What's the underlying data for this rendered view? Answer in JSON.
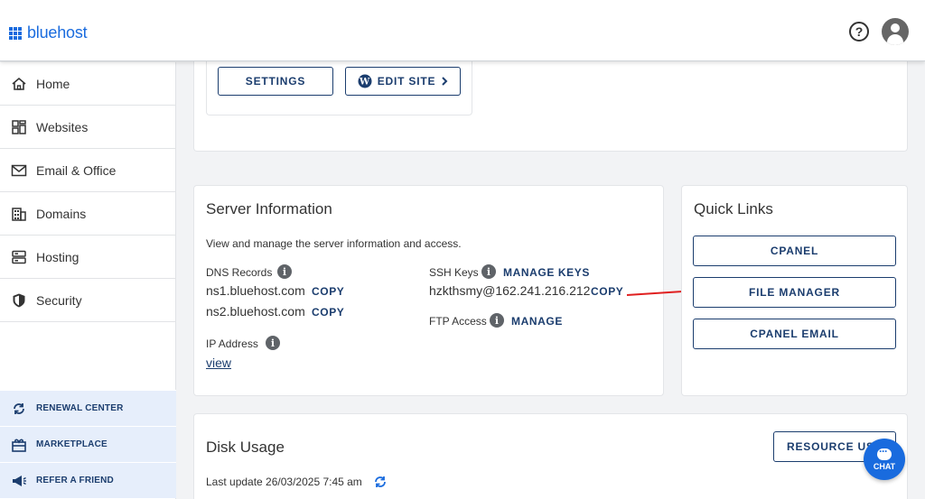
{
  "header": {
    "logo_text": "bluehost",
    "help_icon": "question-circle-icon",
    "avatar_icon": "user-avatar-icon"
  },
  "sidebar": {
    "items": [
      {
        "label": "Home",
        "icon": "home-icon"
      },
      {
        "label": "Websites",
        "icon": "websites-icon"
      },
      {
        "label": "Email & Office",
        "icon": "envelope-icon"
      },
      {
        "label": "Domains",
        "icon": "building-icon"
      },
      {
        "label": "Hosting",
        "icon": "server-icon"
      },
      {
        "label": "Security",
        "icon": "shield-icon"
      }
    ],
    "sub_items": [
      {
        "label": "RENEWAL CENTER",
        "icon": "renew-icon"
      },
      {
        "label": "MARKETPLACE",
        "icon": "gift-icon"
      },
      {
        "label": "REFER A FRIEND",
        "icon": "megaphone-icon"
      }
    ]
  },
  "site_card": {
    "settings_label": "SETTINGS",
    "edit_site_label": "EDIT SITE"
  },
  "server_info": {
    "title": "Server Information",
    "description": "View and manage the server information and access.",
    "dns_label": "DNS Records",
    "ns1": "ns1.bluehost.com",
    "ns2": "ns2.bluehost.com",
    "copy_label": "COPY",
    "ip_label": "IP Address",
    "ip_link": "view",
    "ssh_label": "SSH Keys",
    "manage_keys_label": "MANAGE KEYS",
    "ssh_value": "hzkthsmy@162.241.216.212",
    "ftp_label": "FTP Access",
    "manage_label": "MANAGE"
  },
  "quick_links": {
    "title": "Quick Links",
    "cpanel_label": "CPANEL",
    "file_manager_label": "FILE MANAGER",
    "cpanel_email_label": "CPANEL EMAIL"
  },
  "disk_usage": {
    "title": "Disk Usage",
    "last_update": "Last update 26/03/2025 7:45 am",
    "resource_button": "RESOURCE USA"
  },
  "chat": {
    "label": "CHAT"
  },
  "colors": {
    "brand": "#196bde",
    "navy": "#1b3d6e",
    "arrow": "#e02020"
  }
}
